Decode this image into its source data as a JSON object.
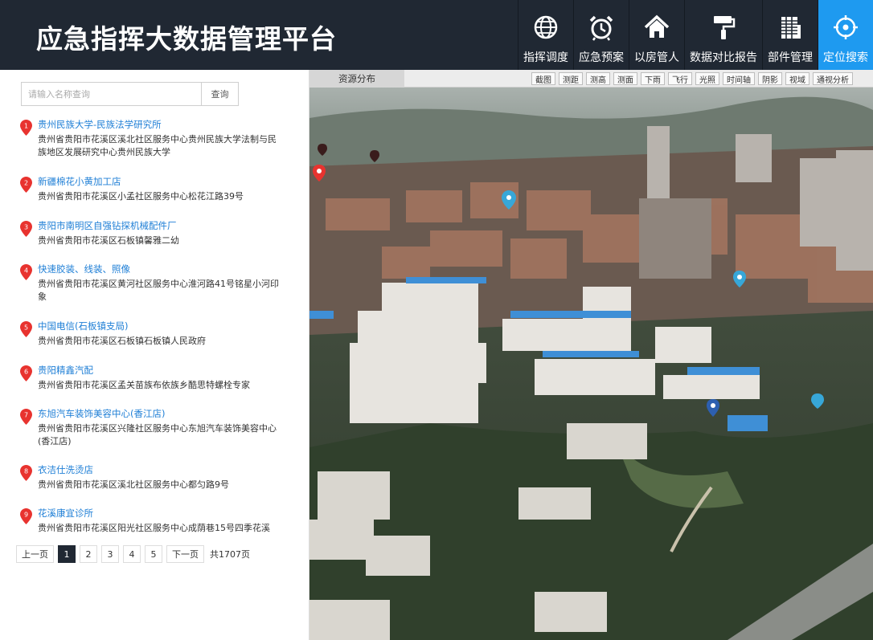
{
  "header": {
    "title": "应急指挥大数据管理平台",
    "nav": [
      {
        "label": "指挥调度",
        "icon": "globe-icon",
        "active": false
      },
      {
        "label": "应急预案",
        "icon": "alarm-clock-icon",
        "active": false
      },
      {
        "label": "以房管人",
        "icon": "house-icon",
        "active": false
      },
      {
        "label": "数据对比报告",
        "icon": "paint-roller-icon",
        "active": false
      },
      {
        "label": "部件管理",
        "icon": "building-icon",
        "active": false
      },
      {
        "label": "定位搜索",
        "icon": "locate-target-icon",
        "active": true
      }
    ]
  },
  "search": {
    "placeholder": "请输入名称查询",
    "button": "查询"
  },
  "results": [
    {
      "num": "1",
      "name": "贵州民族大学-民族法学研究所",
      "address": "贵州省贵阳市花溪区溪北社区服务中心贵州民族大学法制与民族地区发展研究中心贵州民族大学"
    },
    {
      "num": "2",
      "name": "新疆棉花小黄加工店",
      "address": "贵州省贵阳市花溪区小孟社区服务中心松花江路39号"
    },
    {
      "num": "3",
      "name": "贵阳市南明区自强钻探机械配件厂",
      "address": "贵州省贵阳市花溪区石板镇馨雅二幼"
    },
    {
      "num": "4",
      "name": "快速胶装、线装、照像",
      "address": "贵州省贵阳市花溪区黄河社区服务中心淮河路41号铭星小河印象"
    },
    {
      "num": "5",
      "name": "中国电信(石板镇支局)",
      "address": "贵州省贵阳市花溪区石板镇石板镇人民政府"
    },
    {
      "num": "6",
      "name": "贵阳精鑫汽配",
      "address": "贵州省贵阳市花溪区孟关苗族布依族乡酷思特螺栓专家"
    },
    {
      "num": "7",
      "name": "东旭汽车装饰美容中心(香江店)",
      "address": "贵州省贵阳市花溪区兴隆社区服务中心东旭汽车装饰美容中心(香江店)"
    },
    {
      "num": "8",
      "name": "衣洁仕洗烫店",
      "address": "贵州省贵阳市花溪区溪北社区服务中心都匀路9号"
    },
    {
      "num": "9",
      "name": "花溪康宜诊所",
      "address": "贵州省贵阳市花溪区阳光社区服务中心成荫巷15号四季花溪"
    }
  ],
  "pager": {
    "prev": "上一页",
    "pages": [
      "1",
      "2",
      "3",
      "4",
      "5"
    ],
    "current": "1",
    "next": "下一页",
    "total": "共1707页"
  },
  "map": {
    "resource_tab": "资源分布",
    "tools": [
      "截图",
      "测距",
      "测高",
      "测面",
      "下雨",
      "飞行",
      "光照",
      "时间轴",
      "阴影",
      "视域",
      "通视分析"
    ]
  },
  "colors": {
    "header_bg": "#202833",
    "accent": "#1e9af0",
    "link": "#1f7fd6",
    "pin": "#e8332f"
  }
}
